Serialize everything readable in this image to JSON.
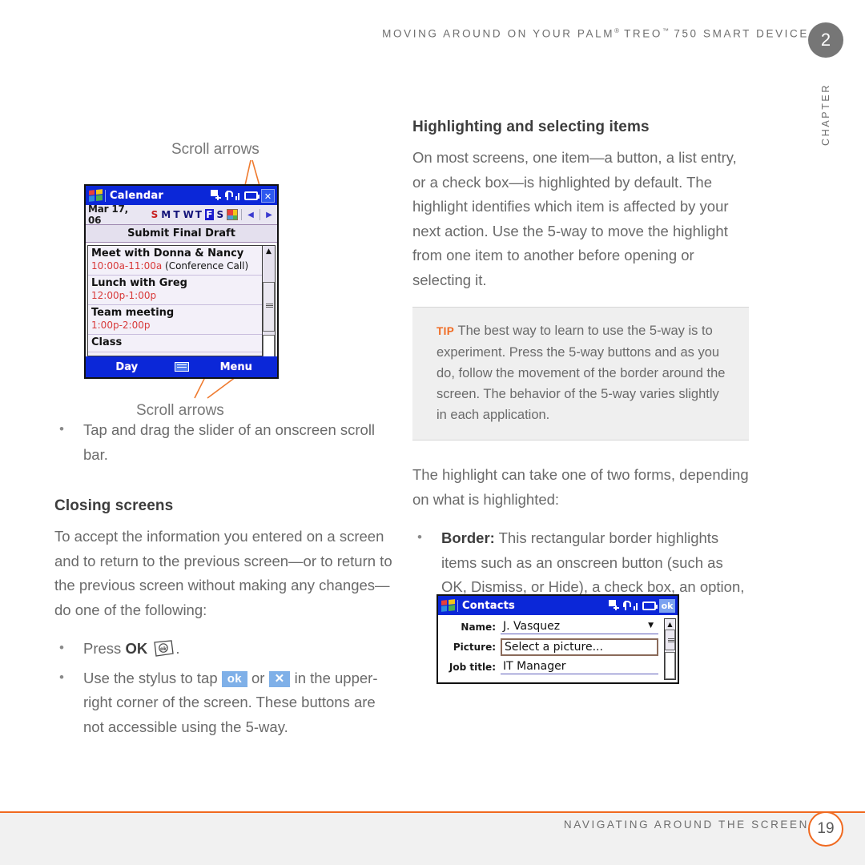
{
  "header": {
    "running_head": "MOVING AROUND ON YOUR PALM",
    "running_head_reg": "®",
    "running_head_2": " TREO",
    "running_head_tm": "™",
    "running_head_3": " 750 SMART DEVICE",
    "chapter_number": "2",
    "chapter_word": "CHAPTER"
  },
  "colors": {
    "accent_orange": "#f0691f",
    "chapter_badge": "#767676",
    "body_text": "#6a6a6a",
    "heading_text": "#3d3d3d",
    "tip_background": "#efefef",
    "chip_blue": "#7fb0e8",
    "device_titlebar_blue": "#0b27d8"
  },
  "left_column": {
    "annotation_top": "Scroll arrows",
    "annotation_bottom": "Scroll arrows",
    "bullet_slider": "Tap and drag the slider of an onscreen scroll bar.",
    "heading_closing": "Closing screens",
    "paragraph_closing": "To accept the information you entered on a screen and to return to the previous screen—or to return to the previous screen without making any changes—do one of the following:",
    "bullet_press_prefix": "Press ",
    "bullet_press_bold": "OK",
    "bullet_press_suffix": ".",
    "bullet_stylus_a": "Use the stylus to tap ",
    "bullet_stylus_chip1": "ok",
    "bullet_stylus_b": " or ",
    "bullet_stylus_chip2": "✕",
    "bullet_stylus_c": " in the upper-right corner of the screen. These buttons are not accessible using the 5-way."
  },
  "right_column": {
    "heading_highlighting": "Highlighting and selecting items",
    "paragraph_highlighting": "On most screens, one item—a button, a list entry, or a check box—is highlighted by default. The highlight identifies which item is affected by your next action. Use the 5-way to move the highlight from one item to another before opening or selecting it.",
    "tip_label": "TIP",
    "tip_text": "The best way to learn to use the 5-way is to experiment. Press the 5-way buttons and as you do, follow the movement of the border around the screen. The behavior of the 5-way varies slightly in each application.",
    "paragraph_forms": "The highlight can take one of two forms, depending on what is highlighted:",
    "bullet_border_bold": "Border:",
    "bullet_border_text": " This rectangular border highlights items such as an onscreen button (such as OK, Dismiss, or Hide), a check box, an option, or a web link."
  },
  "calendar_device": {
    "title": "Calendar",
    "date": "Mar 17, 06",
    "day_initials": [
      "S",
      "M",
      "T",
      "W",
      "T",
      "F",
      "S"
    ],
    "selected_day_index": 5,
    "subject": "Submit Final Draft",
    "appointments": [
      {
        "title": "Meet with Donna & Nancy",
        "hours": "10:00a-11:00a",
        "note": "(Conference Call)"
      },
      {
        "title": "Lunch with Greg",
        "hours": "12:00p-1:00p",
        "note": ""
      },
      {
        "title": "Team meeting",
        "hours": "1:00p-2:00p",
        "note": ""
      },
      {
        "title": "Class",
        "hours": "",
        "note": ""
      }
    ],
    "softkey_left": "Day",
    "softkey_right": "Menu",
    "scroll_up_glyph": "▲",
    "scroll_down_glyph": "▼",
    "nav_prev_glyph": "◀",
    "nav_next_glyph": "▶",
    "close_button": "✕"
  },
  "contacts_device": {
    "title": "Contacts",
    "ok_button": "ok",
    "rows": [
      {
        "label": "Name:",
        "value": "J. Vasquez",
        "boxed": false,
        "caret": true
      },
      {
        "label": "Picture:",
        "value": "Select a picture...",
        "boxed": true,
        "caret": false
      },
      {
        "label": "Job title:",
        "value": "IT Manager",
        "boxed": false,
        "caret": false
      }
    ],
    "scroll_up_glyph": "▲",
    "scroll_down_glyph": "▼"
  },
  "footer": {
    "text": "NAVIGATING AROUND THE SCREEN",
    "page_number": "19"
  }
}
